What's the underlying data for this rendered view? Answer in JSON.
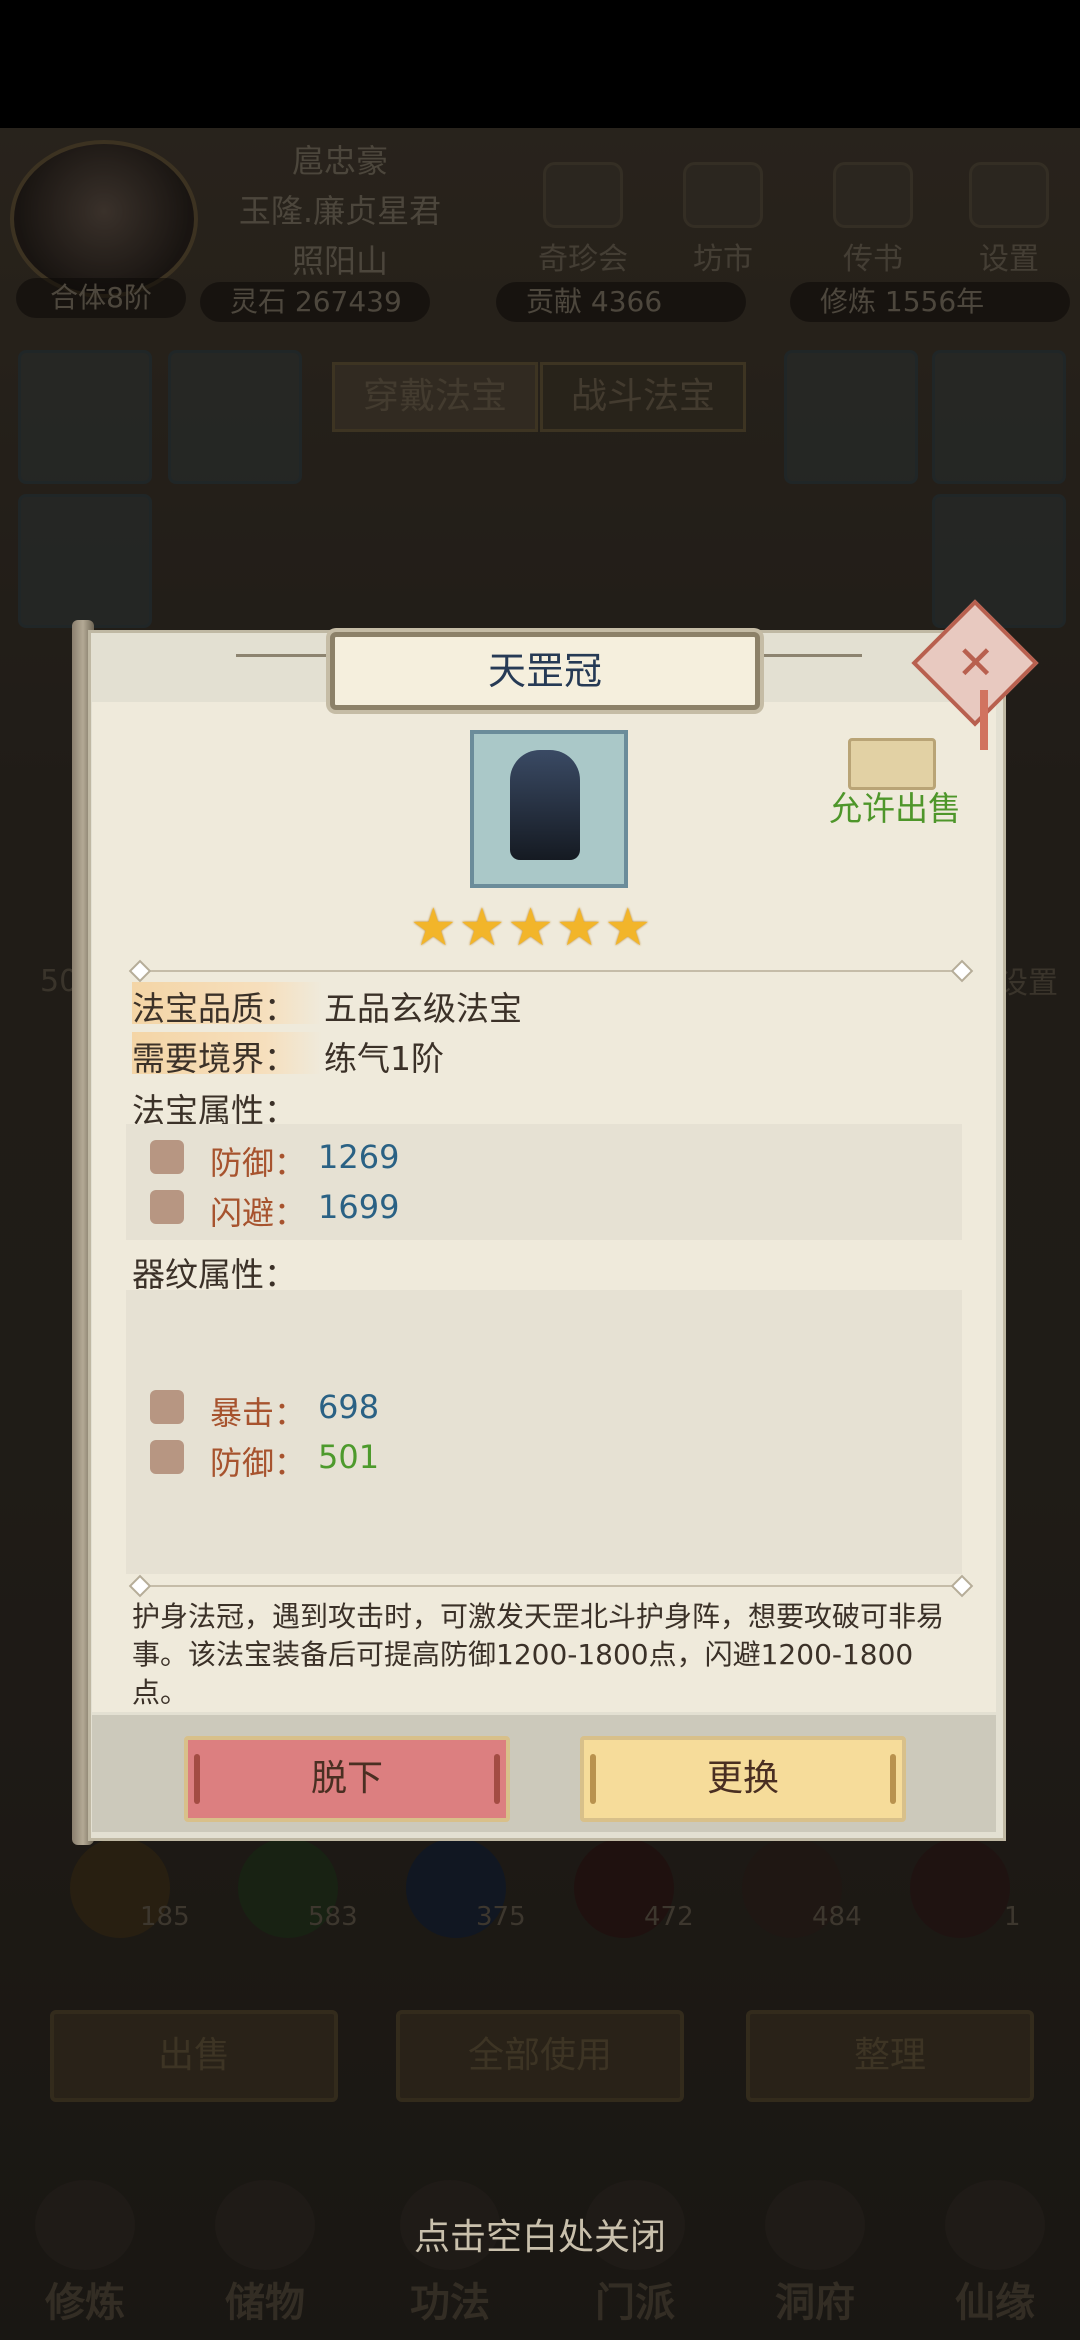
{
  "header": {
    "name": "扈忠豪",
    "title": "玉隆.廉贞星君",
    "sect": "照阳山",
    "realm": "合体8阶",
    "lingshi": "灵石 267439",
    "gongxian": "贡献 4366",
    "xiulian": "修炼 1556年"
  },
  "top_icons": [
    {
      "label": "奇珍会",
      "icon": "treasure-pavilion-icon"
    },
    {
      "label": "坊市",
      "icon": "market-icon"
    },
    {
      "label": "传书",
      "icon": "scroll-letter-icon"
    },
    {
      "label": "设置",
      "icon": "gear-icon"
    }
  ],
  "equip_tabs": {
    "active": "穿戴法宝",
    "inactive": "战斗法宝"
  },
  "background_labels": {
    "left_num": "50",
    "right_setting": "设置"
  },
  "inventory_counts": [
    "185",
    "583",
    "375",
    "472",
    "484",
    "1"
  ],
  "bottom_buttons": [
    "出售",
    "全部使用",
    "整理"
  ],
  "nav": [
    "修炼",
    "储物",
    "功法",
    "门派",
    "洞府",
    "仙缘"
  ],
  "close_hint": "点击空白处关闭",
  "dialog": {
    "title": "天罡冠",
    "sell_label": "允许出售",
    "stars": 5,
    "star_glyphs": "★★★★★",
    "quality_label": "法宝品质：",
    "quality_value": "五品玄级法宝",
    "realm_label": "需要境界：",
    "realm_value": "练气1阶",
    "attr_header": "法宝属性：",
    "attrs": [
      {
        "name": "防御：",
        "value": "1269",
        "icon": "shield-icon"
      },
      {
        "name": "闪避：",
        "value": "1699",
        "icon": "dodge-icon"
      }
    ],
    "pattern_header": "器纹属性：",
    "pattern_attrs": [
      {
        "name": "暴击：",
        "value": "698",
        "icon": "critical-icon"
      },
      {
        "name": "防御：",
        "value": "501",
        "icon": "shield-icon"
      }
    ],
    "description": "护身法冠，遇到攻击时，可激发天罡北斗护身阵，想要攻破可非易事。该法宝装备后可提高防御1200-1800点，闪避1200-1800点。",
    "unequip_button": "脱下",
    "replace_button": "更换",
    "close_glyph": "✕"
  },
  "colors": {
    "title_text": "#263a55",
    "attr_name": "#a7532e",
    "attr_value": "#2a6184",
    "pattern_value_green": "#4d9a2c",
    "sell_green": "#4e962a",
    "star": "#f2b52a",
    "unequip_bg": "#dc7f80",
    "replace_bg": "#f6dc9a"
  }
}
